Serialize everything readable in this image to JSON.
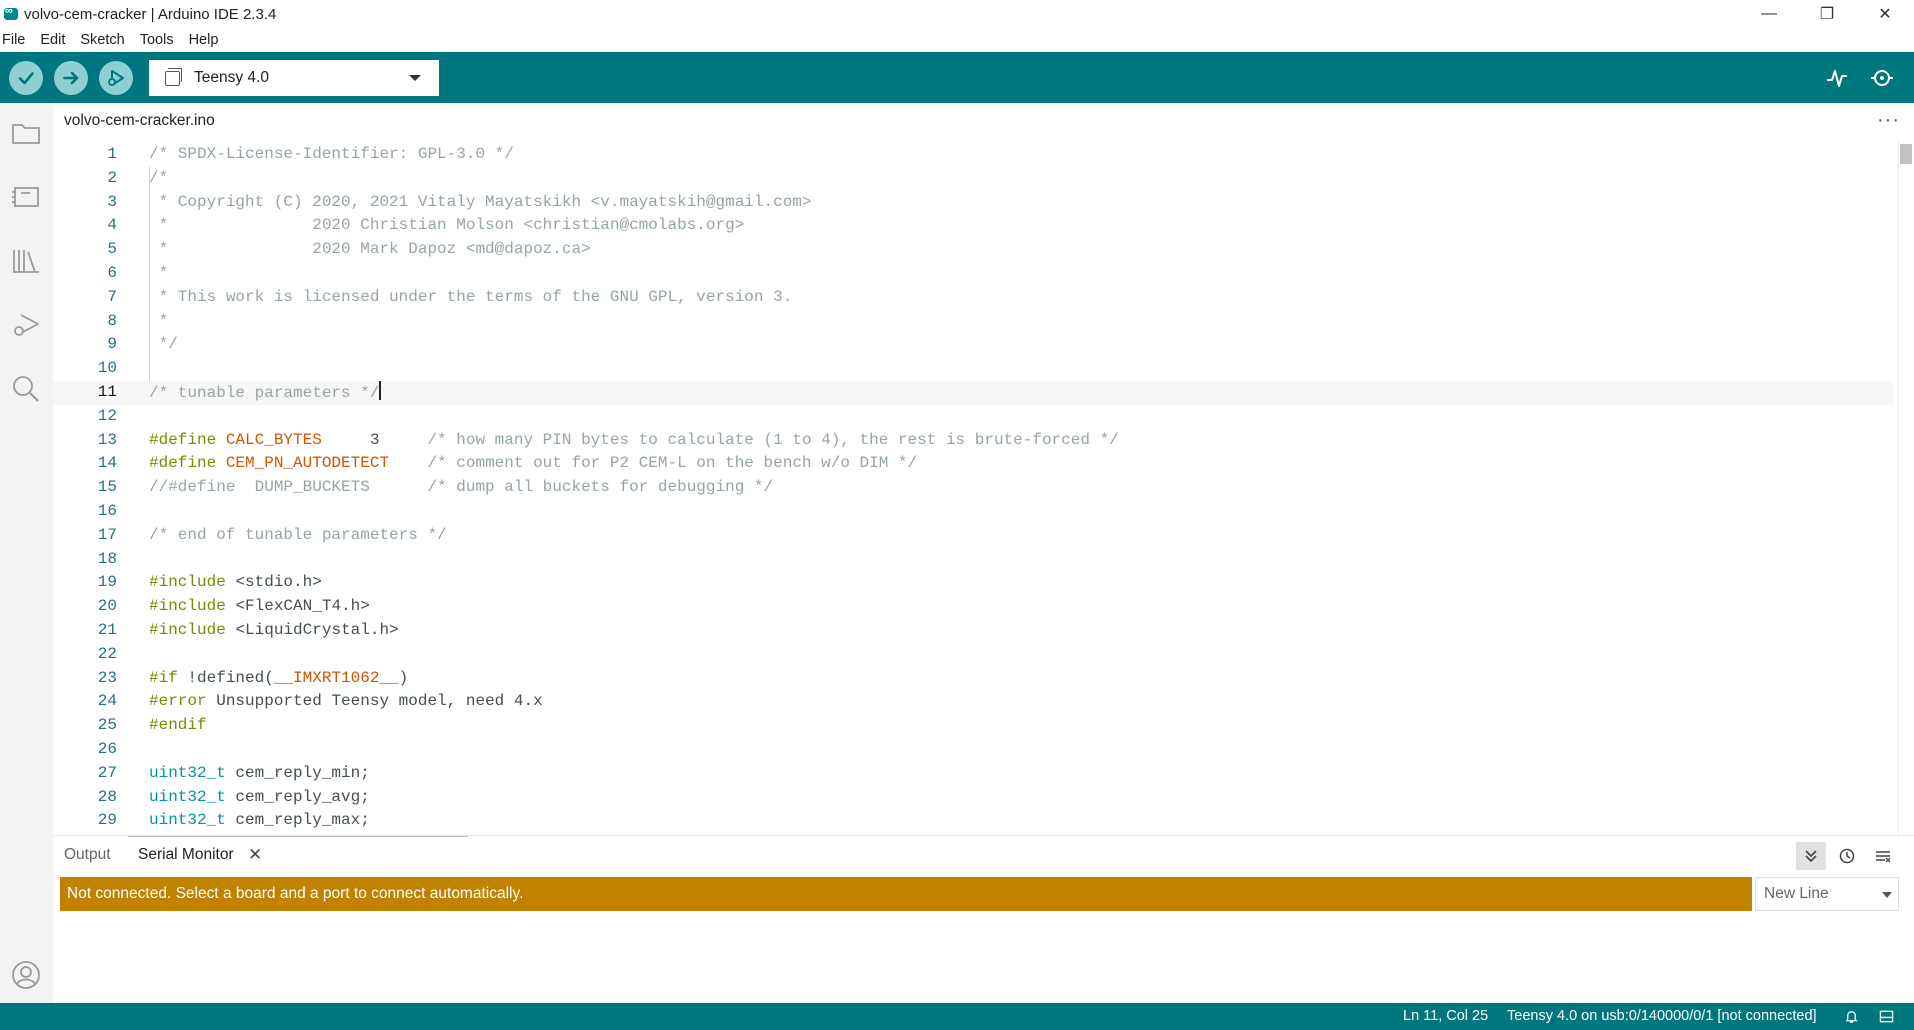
{
  "window": {
    "title": "volvo-cem-cracker | Arduino IDE 2.3.4",
    "minimize": "—",
    "restore": "❐",
    "close": "✕"
  },
  "menu": [
    "File",
    "Edit",
    "Sketch",
    "Tools",
    "Help"
  ],
  "toolbar": {
    "verify_icon": "check-icon",
    "upload_icon": "arrow-right-icon",
    "debug_icon": "debug-icon",
    "board": "Teensy 4.0",
    "plotter_icon": "serial-plotter-icon",
    "monitor_icon": "serial-monitor-icon",
    "accent": "#00767e"
  },
  "sidebar": [
    "folder-icon",
    "board-manager-icon",
    "library-icon",
    "debug-icon",
    "search-icon",
    "account-icon"
  ],
  "editor": {
    "tab": "volvo-cem-cracker.ino",
    "more": "···",
    "current_line": 11,
    "lines": [
      [
        [
          "c",
          "/* SPDX-License-Identifier: GPL-3.0 */"
        ]
      ],
      [
        [
          "c",
          "/*"
        ]
      ],
      [
        [
          "c",
          " * Copyright (C) 2020, 2021 Vitaly Mayatskikh <v.mayatskih@gmail.com>"
        ]
      ],
      [
        [
          "c",
          " *               2020 Christian Molson <christian@cmolabs.org>"
        ]
      ],
      [
        [
          "c",
          " *               2020 Mark Dapoz <md@dapoz.ca>"
        ]
      ],
      [
        [
          "c",
          " *"
        ]
      ],
      [
        [
          "c",
          " * This work is licensed under the terms of the GNU GPL, version 3."
        ]
      ],
      [
        [
          "c",
          " *"
        ]
      ],
      [
        [
          "c",
          " */"
        ]
      ],
      [],
      [
        [
          "c",
          "/* tunable parameters */"
        ]
      ],
      [],
      [
        [
          "p",
          "#define "
        ],
        [
          "m",
          "CALC_BYTES"
        ],
        [
          "n",
          "     3     "
        ],
        [
          "c",
          "/* how many PIN bytes to calculate (1 to 4), the rest is brute-forced */"
        ]
      ],
      [
        [
          "p",
          "#define "
        ],
        [
          "m",
          "CEM_PN_AUTODETECT"
        ],
        [
          "n",
          "    "
        ],
        [
          "c",
          "/* comment out for P2 CEM-L on the bench w/o DIM */"
        ]
      ],
      [
        [
          "c",
          "//#define  DUMP_BUCKETS      /* dump all buckets for debugging */"
        ]
      ],
      [],
      [
        [
          "c",
          "/* end of tunable parameters */"
        ]
      ],
      [],
      [
        [
          "p",
          "#include "
        ],
        [
          "n",
          "<stdio.h>"
        ]
      ],
      [
        [
          "p",
          "#include "
        ],
        [
          "n",
          "<FlexCAN_T4.h>"
        ]
      ],
      [
        [
          "p",
          "#include "
        ],
        [
          "n",
          "<LiquidCrystal.h>"
        ]
      ],
      [],
      [
        [
          "p",
          "#if "
        ],
        [
          "n",
          "!defined("
        ],
        [
          "m",
          "__IMXRT1062__"
        ],
        [
          "n",
          ")"
        ]
      ],
      [
        [
          "p",
          "#error "
        ],
        [
          "n",
          "Unsupported Teensy model, need 4.x"
        ]
      ],
      [
        [
          "p",
          "#endif"
        ]
      ],
      [],
      [
        [
          "t",
          "uint32_t"
        ],
        [
          "n",
          " cem_reply_min;"
        ]
      ],
      [
        [
          "t",
          "uint32_t"
        ],
        [
          "n",
          " cem_reply_avg;"
        ]
      ],
      [
        [
          "t",
          "uint32_t"
        ],
        [
          "n",
          " cem_reply_max;"
        ]
      ]
    ]
  },
  "panel": {
    "tab_output": "Output",
    "tab_serial": "Serial Monitor",
    "close": "✕",
    "notice": "Not connected. Select a board and a port to connect automatically.",
    "line_ending": "New Line",
    "notice_color": "#c18200"
  },
  "status": {
    "position": "Ln 11, Col 25",
    "board_port": "Teensy 4.0 on usb:0/140000/0/1 [not connected]"
  }
}
